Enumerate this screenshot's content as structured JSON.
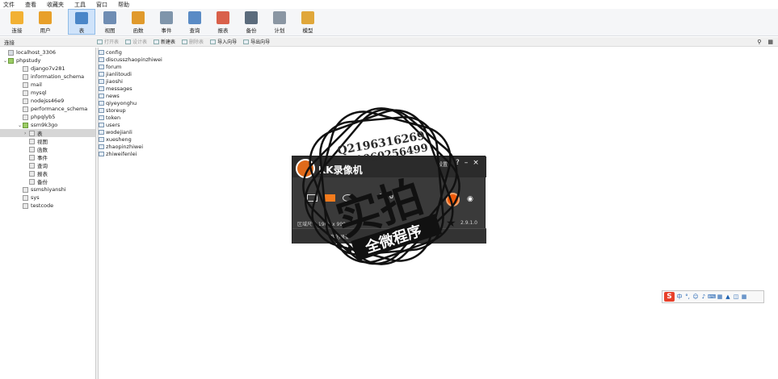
{
  "menu": [
    "文件",
    "查看",
    "收藏夹",
    "工具",
    "窗口",
    "帮助"
  ],
  "toolbar": [
    {
      "label": "连接",
      "icon": "connection-icon",
      "color": "#f2b134"
    },
    {
      "label": "用户",
      "icon": "user-icon",
      "color": "#e8a02a"
    },
    {
      "label": "表",
      "icon": "table-icon",
      "color": "#4a86c8",
      "active": true
    },
    {
      "label": "视图",
      "icon": "view-icon",
      "color": "#6f8db3"
    },
    {
      "label": "函数",
      "icon": "function-icon",
      "color": "#e09a2c"
    },
    {
      "label": "事件",
      "icon": "event-icon",
      "color": "#7f95ab"
    },
    {
      "label": "查询",
      "icon": "query-icon",
      "color": "#5a8bc5"
    },
    {
      "label": "报表",
      "icon": "report-icon",
      "color": "#d9604a"
    },
    {
      "label": "备份",
      "icon": "backup-icon",
      "color": "#5b6b7c"
    },
    {
      "label": "计划",
      "icon": "schedule-icon",
      "color": "#8a96a3"
    },
    {
      "label": "模型",
      "icon": "model-icon",
      "color": "#e0a73a"
    }
  ],
  "subbar": {
    "connection_label": "连接",
    "actions": [
      {
        "label": "打开表",
        "enabled": false
      },
      {
        "label": "设计表",
        "enabled": false
      },
      {
        "label": "新建表",
        "enabled": true
      },
      {
        "label": "删除表",
        "enabled": false
      },
      {
        "label": "导入向导",
        "enabled": true
      },
      {
        "label": "导出向导",
        "enabled": true
      }
    ]
  },
  "sidebar": {
    "items": [
      {
        "label": "localhost_3306",
        "level": 0,
        "kind": "host"
      },
      {
        "label": "phpstudy",
        "level": 0,
        "kind": "conn",
        "expanded": true
      },
      {
        "label": "django7v281",
        "level": 1,
        "kind": "db"
      },
      {
        "label": "information_schema",
        "level": 1,
        "kind": "db"
      },
      {
        "label": "mail",
        "level": 1,
        "kind": "db"
      },
      {
        "label": "mysql",
        "level": 1,
        "kind": "db"
      },
      {
        "label": "nodejss46e9",
        "level": 1,
        "kind": "db"
      },
      {
        "label": "performance_schema",
        "level": 1,
        "kind": "db"
      },
      {
        "label": "phpqlyb5",
        "level": 1,
        "kind": "db"
      },
      {
        "label": "ssm9k3go",
        "level": 1,
        "kind": "db-open",
        "expanded": true
      },
      {
        "label": "表",
        "level": 2,
        "kind": "table",
        "selected": true
      },
      {
        "label": "视图",
        "level": 2,
        "kind": "view"
      },
      {
        "label": "函数",
        "level": 2,
        "kind": "func"
      },
      {
        "label": "事件",
        "level": 2,
        "kind": "event"
      },
      {
        "label": "查询",
        "level": 2,
        "kind": "query"
      },
      {
        "label": "报表",
        "level": 2,
        "kind": "report"
      },
      {
        "label": "备份",
        "level": 2,
        "kind": "backup"
      },
      {
        "label": "ssmshiyanshi",
        "level": 1,
        "kind": "db"
      },
      {
        "label": "sys",
        "level": 1,
        "kind": "db"
      },
      {
        "label": "testcode",
        "level": 1,
        "kind": "db"
      }
    ]
  },
  "tables": [
    "config",
    "discusszhaopinzhiwei",
    "forum",
    "jianlitoudi",
    "jiaoshi",
    "messages",
    "news",
    "qiyeyonghu",
    "storeup",
    "token",
    "users",
    "wodejianli",
    "xuesheng",
    "zhaopinzhiwei",
    "zhiweifenlei"
  ],
  "recorder": {
    "title": "KK录像机",
    "settings": "设置",
    "time": "00:0",
    "area": "区域尺寸 1906 x 990",
    "version": "2.9.1.0",
    "mine": "我的录像"
  },
  "watermark": {
    "stamp_main": "实拍",
    "stamp_sub": "全微程序",
    "phone1": "Q2196316269",
    "phone2": "1060256499"
  },
  "ime": {
    "logo": "S",
    "mode": "中"
  }
}
